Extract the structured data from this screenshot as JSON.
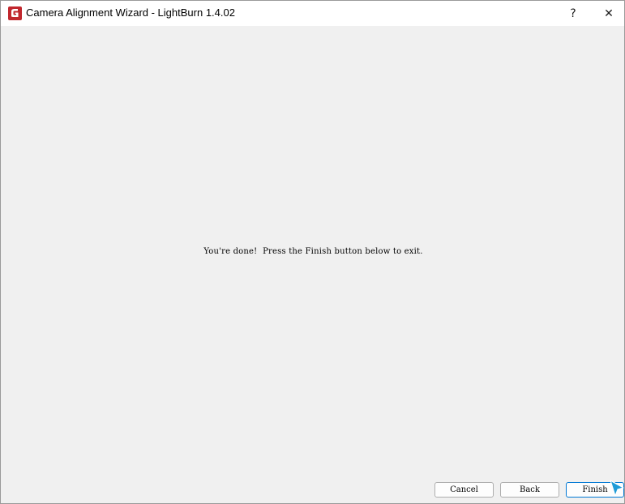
{
  "window": {
    "title": "Camera Alignment Wizard - LightBurn 1.4.02",
    "help_label": "?",
    "close_label": "✕"
  },
  "content": {
    "message": "You're done!  Press the Finish button below to exit."
  },
  "buttons": {
    "cancel": "Cancel",
    "back": "Back",
    "finish": "Finish"
  },
  "icons": {
    "app": "lightburn-logo-icon",
    "cursor": "mouse-pointer-icon"
  },
  "colors": {
    "app_icon_red": "#c1272d",
    "focus_border": "#0078d4",
    "cursor_blue": "#1e9bd7"
  }
}
